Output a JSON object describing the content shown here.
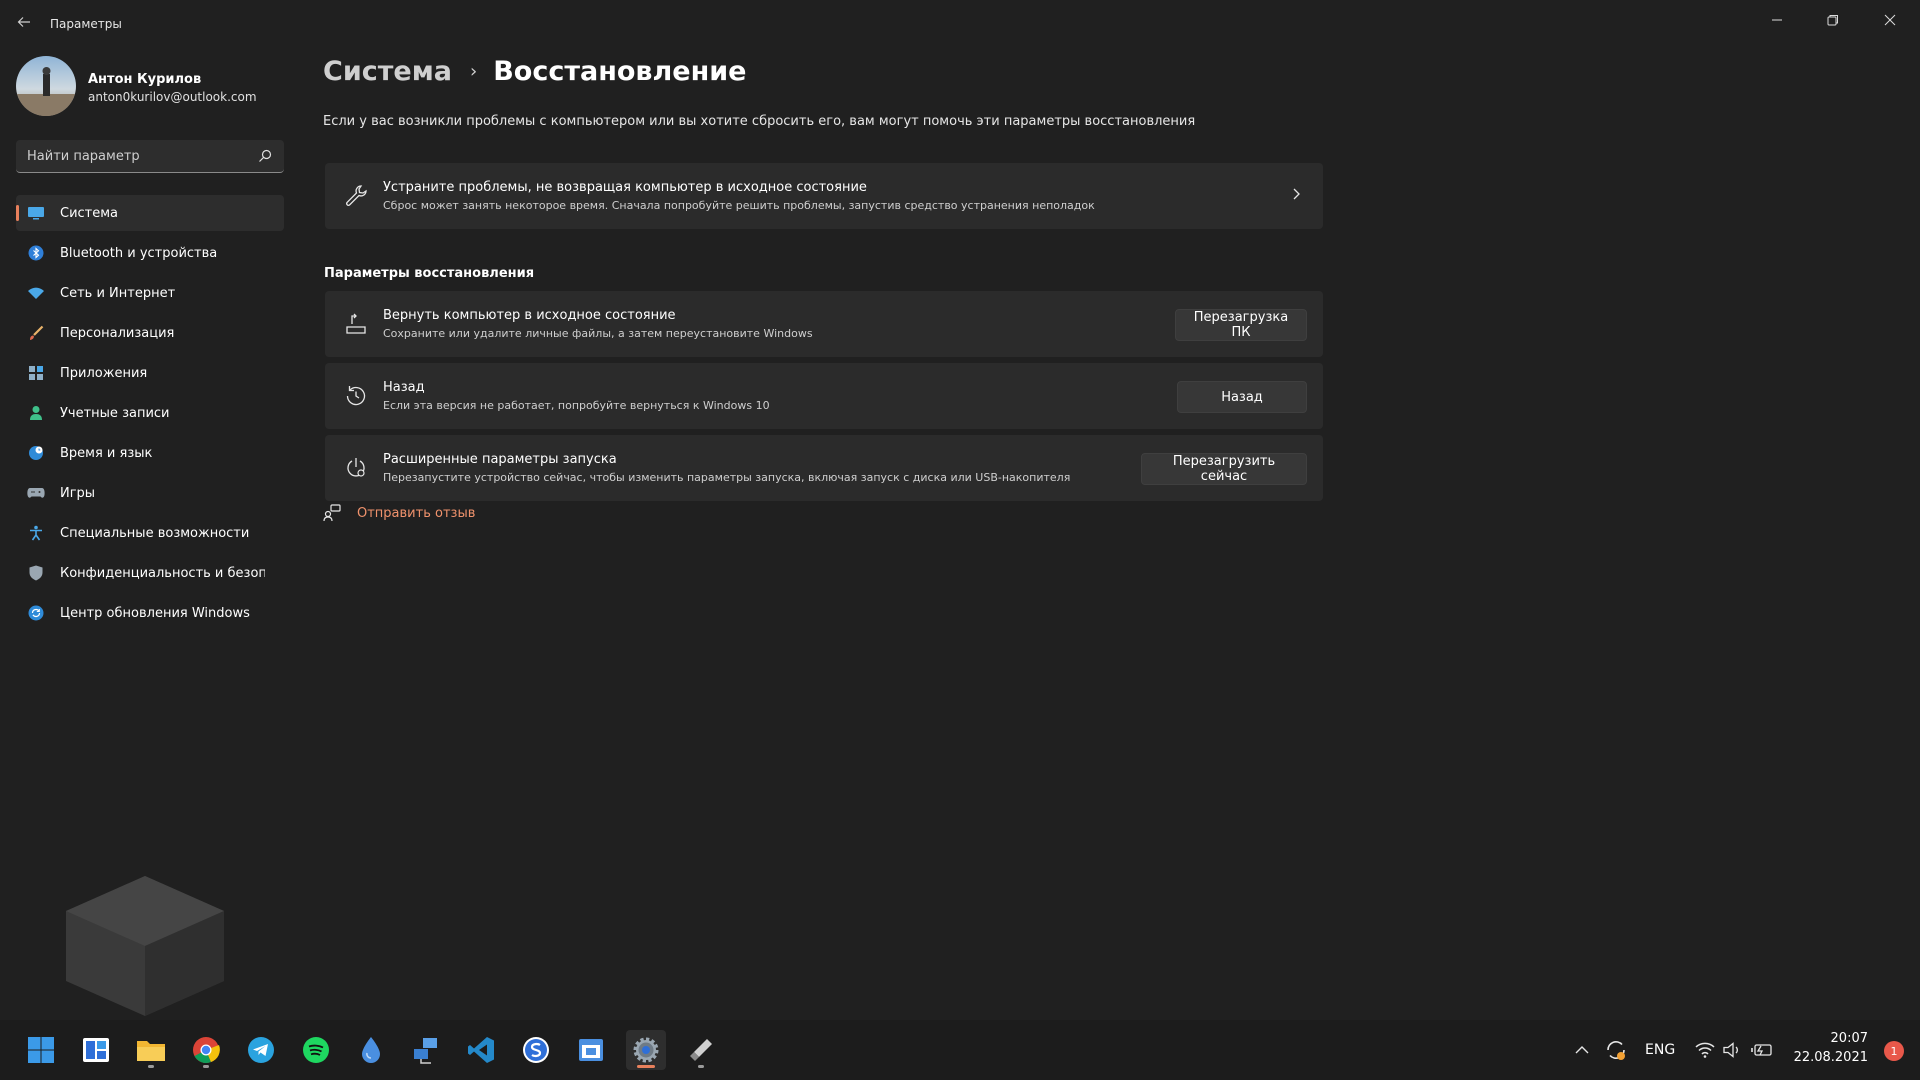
{
  "window": {
    "title": "Параметры",
    "back_icon": "arrow-left-icon",
    "controls": [
      "minimize",
      "restore",
      "close"
    ]
  },
  "profile": {
    "name": "Антон Курилов",
    "email": "anton0kurilov@outlook.com"
  },
  "search": {
    "placeholder": "Найти параметр"
  },
  "sidebar": {
    "items": [
      {
        "label": "Система",
        "icon": "display-icon",
        "active": true
      },
      {
        "label": "Bluetooth и устройства",
        "icon": "bluetooth-icon"
      },
      {
        "label": "Сеть и Интернет",
        "icon": "wifi-icon"
      },
      {
        "label": "Персонализация",
        "icon": "brush-icon"
      },
      {
        "label": "Приложения",
        "icon": "apps-icon"
      },
      {
        "label": "Учетные записи",
        "icon": "person-icon"
      },
      {
        "label": "Время и язык",
        "icon": "globe-clock-icon"
      },
      {
        "label": "Игры",
        "icon": "gamepad-icon"
      },
      {
        "label": "Специальные возможности",
        "icon": "accessibility-icon"
      },
      {
        "label": "Конфиденциальность и безопасность",
        "icon": "shield-icon"
      },
      {
        "label": "Центр обновления Windows",
        "icon": "update-icon"
      }
    ]
  },
  "main": {
    "breadcrumb": {
      "parent": "Система",
      "separator": "›",
      "current": "Восстановление"
    },
    "description": "Если у вас возникли проблемы с компьютером или вы хотите сбросить его, вам могут помочь эти параметры восстановления",
    "troubleshoot": {
      "title": "Устраните проблемы, не возвращая компьютер в исходное состояние",
      "subtitle": "Сброс может занять некоторое время. Сначала попробуйте решить проблемы, запустив средство устранения неполадок"
    },
    "section_title": "Параметры восстановления",
    "options": [
      {
        "title": "Вернуть компьютер в исходное состояние",
        "subtitle": "Сохраните или удалите личные файлы, а затем переустановите Windows",
        "button": "Перезагрузка ПК",
        "icon": "reset-pc-icon"
      },
      {
        "title": "Назад",
        "subtitle": "Если эта версия не работает, попробуйте вернуться к Windows 10",
        "button": "Назад",
        "icon": "history-icon"
      },
      {
        "title": "Расширенные параметры запуска",
        "subtitle": "Перезапустите устройство сейчас, чтобы изменить параметры запуска, включая запуск с диска или USB-накопителя",
        "button": "Перезагрузить сейчас",
        "icon": "advanced-startup-icon"
      }
    ],
    "feedback": "Отправить отзыв"
  },
  "taskbar": {
    "apps": [
      "start",
      "widgets",
      "file-explorer",
      "chrome",
      "telegram",
      "spotify",
      "droplet",
      "network-app",
      "vscode",
      "skype-app",
      "calendar",
      "settings",
      "usb-tool"
    ],
    "tray": {
      "language": "ENG",
      "time": "20:07",
      "date": "22.08.2021",
      "notifications": "1"
    }
  },
  "colors": {
    "background": "#202020",
    "card": "#2b2b2b",
    "accent": "#e8805c",
    "link": "#f0926c"
  }
}
